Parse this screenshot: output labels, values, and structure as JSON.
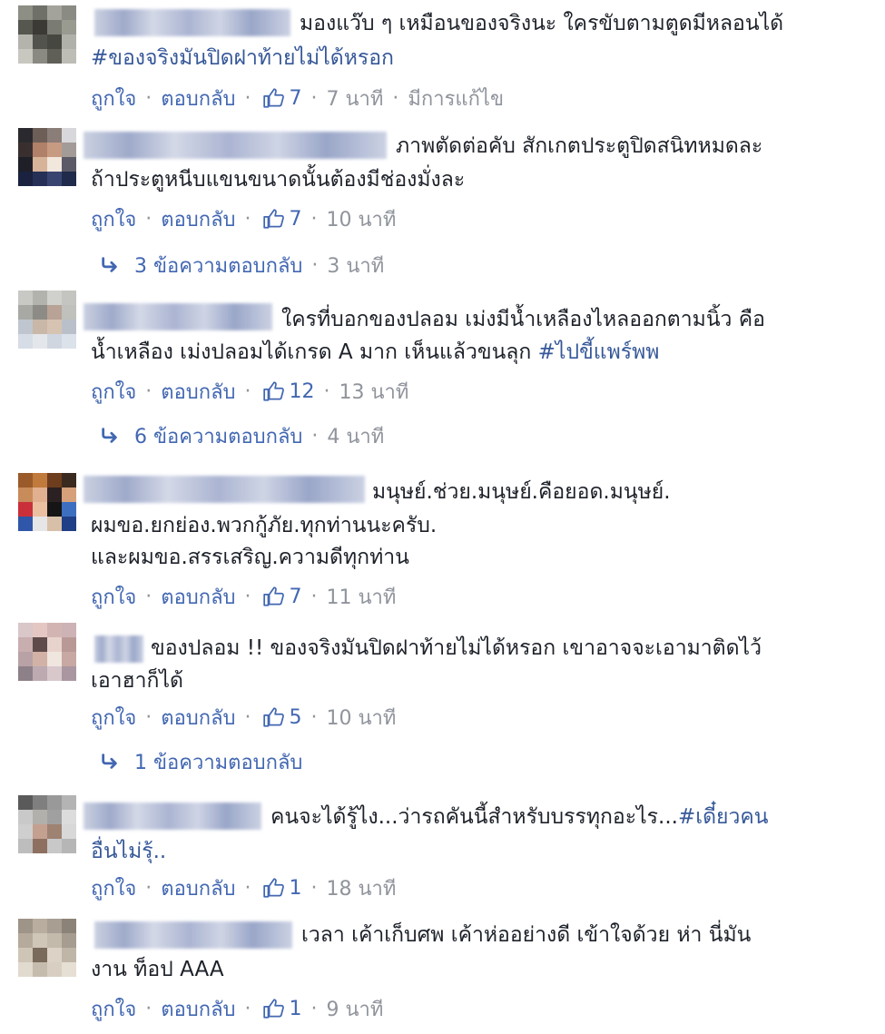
{
  "ui": {
    "like_label": "ถูกใจ",
    "reply_label": "ตอบกลับ",
    "dot": "·",
    "edited_label": "มีการแก้ไข",
    "colors": {
      "link": "#4267b2",
      "meta": "#90949c",
      "hashtag": "#365899",
      "text": "#1d2129"
    },
    "icons": {
      "like": "thumbs-up-icon",
      "reply_arrow": "reply-arrow-icon"
    }
  },
  "comments": [
    {
      "lines": [
        "มองแว๊บ ๆ เหมือนของจริงนะ ใครขับตามตูดมีหลอนได้"
      ],
      "hashtag_line": "#ของจริงมันปิดฝาท้ายไม่ได้หรอก",
      "likes": "7",
      "time": "7 นาที",
      "edited": true
    },
    {
      "lines": [
        "ภาพตัดต่อคับ สักเกตประตูปิดสนิทหมดละ",
        "ถ้าประตูหนีบแขนขนาดนั้นต้องมีช่องมั่งละ"
      ],
      "likes": "7",
      "time": "10 นาที",
      "replies_label": "3 ข้อความตอบกลับ",
      "replies_time": "3 นาที"
    },
    {
      "lines": [
        "ใครที่บอกของปลอม เม่งมีน้ำเหลืองไหลออกตามนิ้ว คือ",
        "น้ำเหลือง เม่งปลอมได้เกรด A มาก เห็นแล้วขนลุก"
      ],
      "hashtag_inline": "#ไปขี้แพร์พพ",
      "likes": "12",
      "time": "13 นาที",
      "replies_label": "6 ข้อความตอบกลับ",
      "replies_time": "4 นาที"
    },
    {
      "lines": [
        "มนุษย์.ช่วย.มนุษย์.คือยอด.มนุษย์.",
        "ผมขอ.ยกย่อง.พวกกู้ภัย.ทุกท่านนะครับ.",
        "และผมขอ.สรรเสริญ.ความดีทุกท่าน"
      ],
      "likes": "7",
      "time": "11 นาที"
    },
    {
      "lines": [
        "ของปลอม !! ของจริงมันปิดฝาท้ายไม่ได้หรอก เขาอาจจะเอามาติดไว้",
        "เอาฮาก็ได้"
      ],
      "likes": "5",
      "time": "10 นาที",
      "replies_label": "1 ข้อความตอบกลับ"
    },
    {
      "lines": [
        "คนจะได้รู้ไง...ว่ารถคันนี้สำหรับบรรทุกอะไร...",
        "อื่นไม่รุ้.."
      ],
      "hashtag_inline": "#เดี๋ยวคน",
      "likes": "1",
      "time": "18 นาที"
    },
    {
      "lines": [
        "เวลา เค้าเก็บศพ เค้าห่ออย่างดี เข้าใจด้วย ห่า นี่มัน",
        "งาน ท็อป AAA"
      ],
      "likes": "1",
      "time": "9 นาที"
    }
  ]
}
